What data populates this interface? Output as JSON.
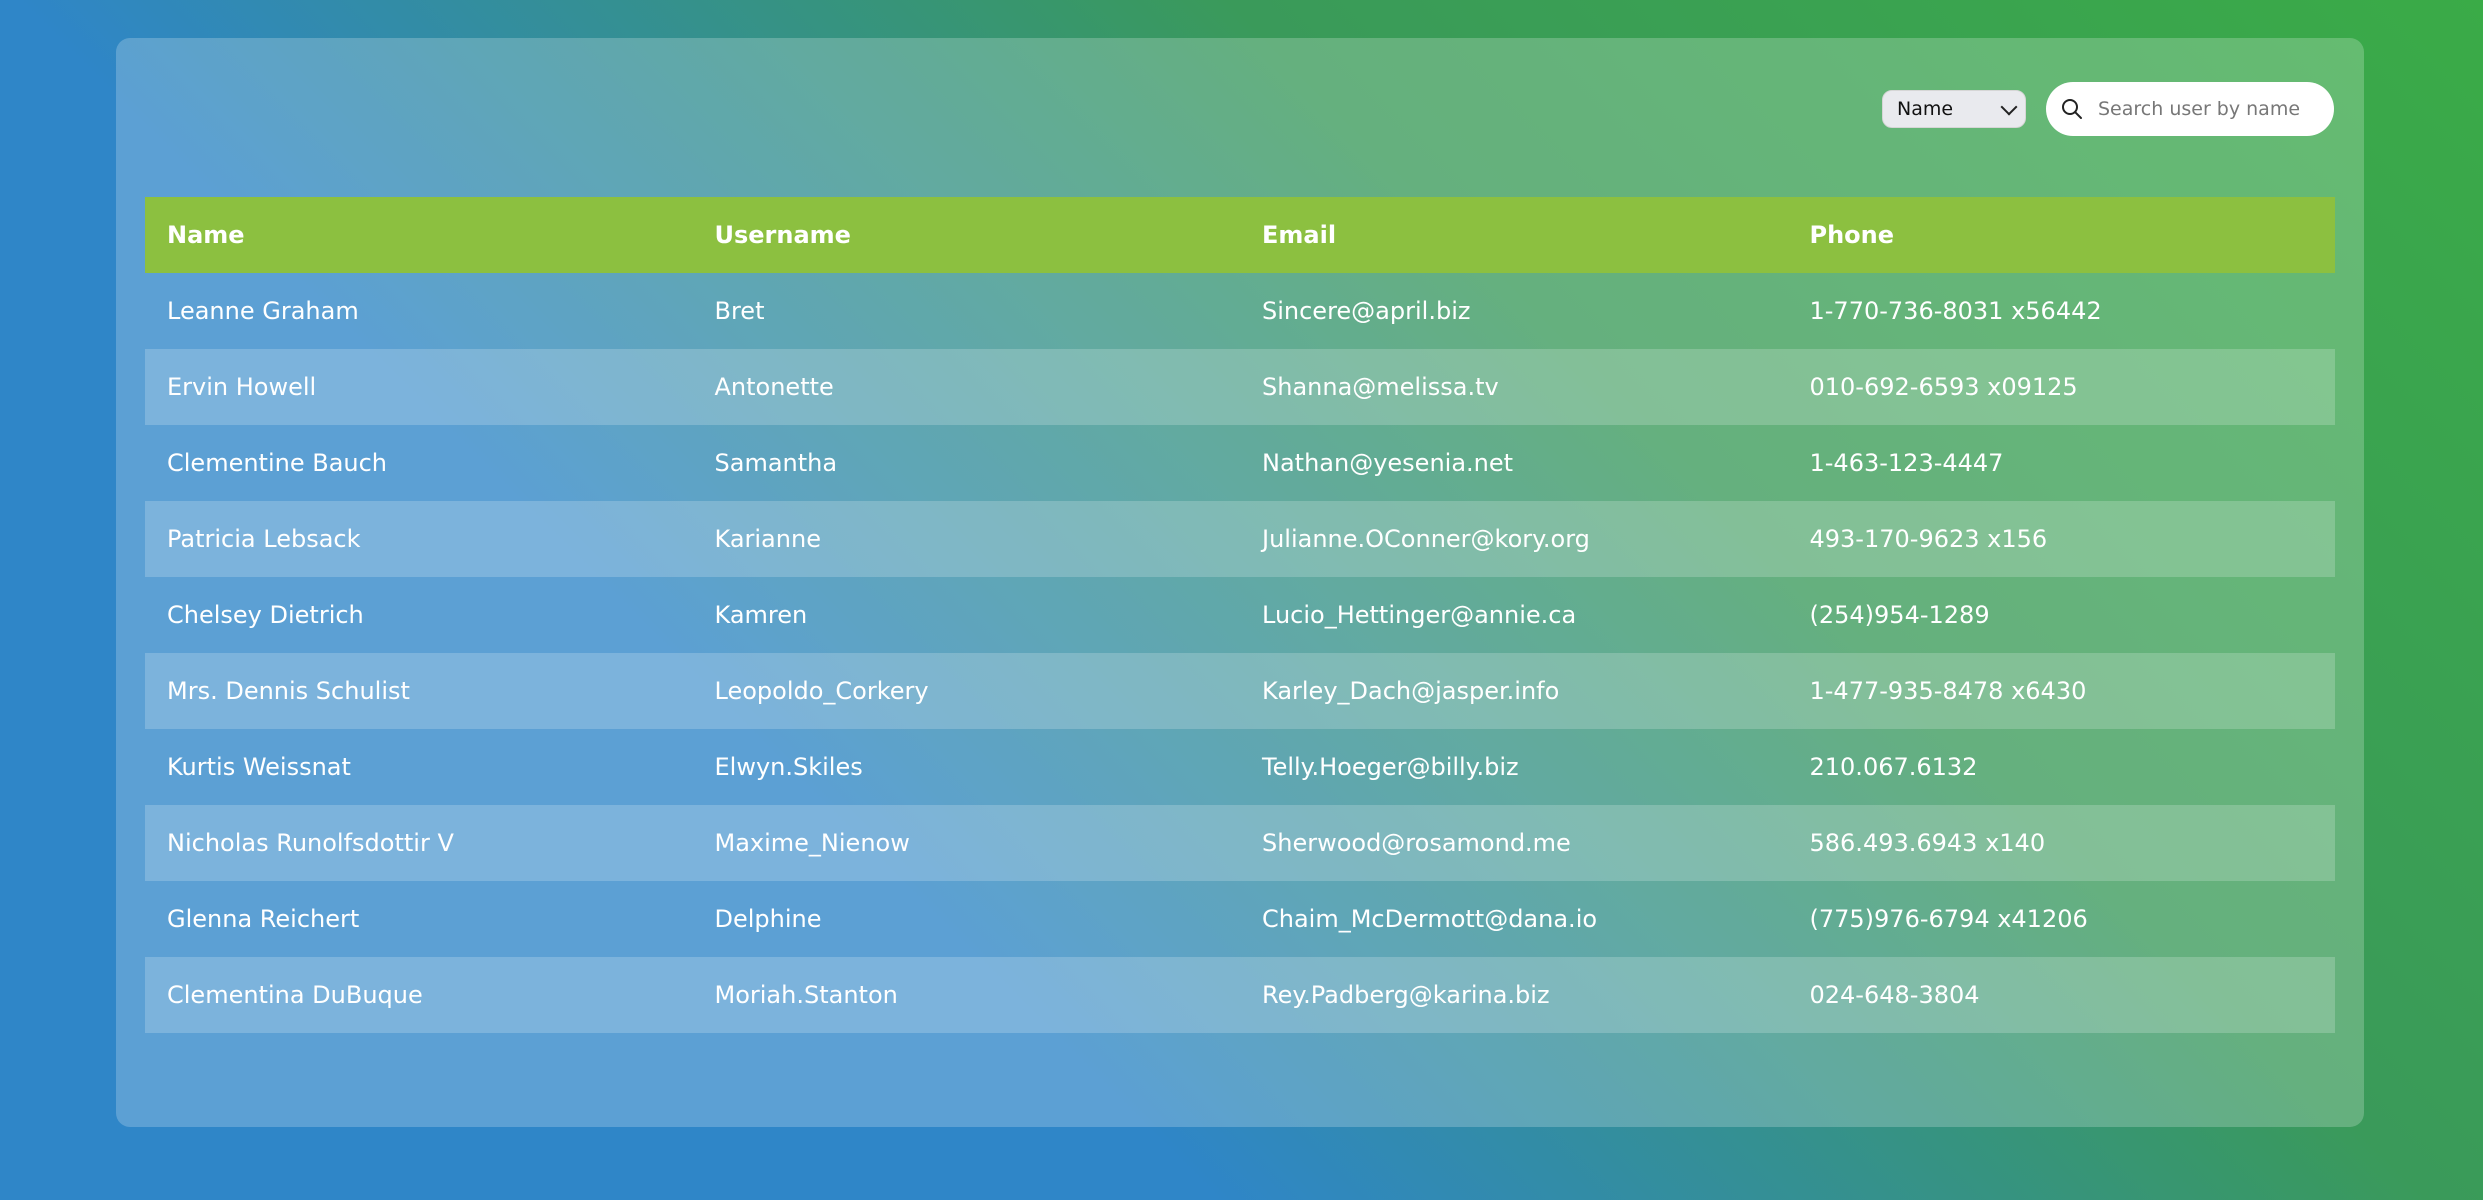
{
  "toolbar": {
    "filter_selected": "Name",
    "search_placeholder": "Search user by name"
  },
  "table": {
    "headers": [
      "Name",
      "Username",
      "Email",
      "Phone"
    ],
    "rows": [
      [
        "Leanne Graham",
        "Bret",
        "Sincere@april.biz",
        "1-770-736-8031 x56442"
      ],
      [
        "Ervin Howell",
        "Antonette",
        "Shanna@melissa.tv",
        "010-692-6593 x09125"
      ],
      [
        "Clementine Bauch",
        "Samantha",
        "Nathan@yesenia.net",
        "1-463-123-4447"
      ],
      [
        "Patricia Lebsack",
        "Karianne",
        "Julianne.OConner@kory.org",
        "493-170-9623 x156"
      ],
      [
        "Chelsey Dietrich",
        "Kamren",
        "Lucio_Hettinger@annie.ca",
        "(254)954-1289"
      ],
      [
        "Mrs. Dennis Schulist",
        "Leopoldo_Corkery",
        "Karley_Dach@jasper.info",
        "1-477-935-8478 x6430"
      ],
      [
        "Kurtis Weissnat",
        "Elwyn.Skiles",
        "Telly.Hoeger@billy.biz",
        "210.067.6132"
      ],
      [
        "Nicholas Runolfsdottir V",
        "Maxime_Nienow",
        "Sherwood@rosamond.me",
        "586.493.6943 x140"
      ],
      [
        "Glenna Reichert",
        "Delphine",
        "Chaim_McDermott@dana.io",
        "(775)976-6794 x41206"
      ],
      [
        "Clementina DuBuque",
        "Moriah.Stanton",
        "Rey.Padberg@karina.biz",
        "024-648-3804"
      ]
    ]
  },
  "icons": {
    "search": "search-icon",
    "select": "chevron-down-icon"
  },
  "colors": {
    "header_bg": "#8cc040",
    "gradient_start": "#2f86c8",
    "gradient_end": "#3aab47"
  }
}
